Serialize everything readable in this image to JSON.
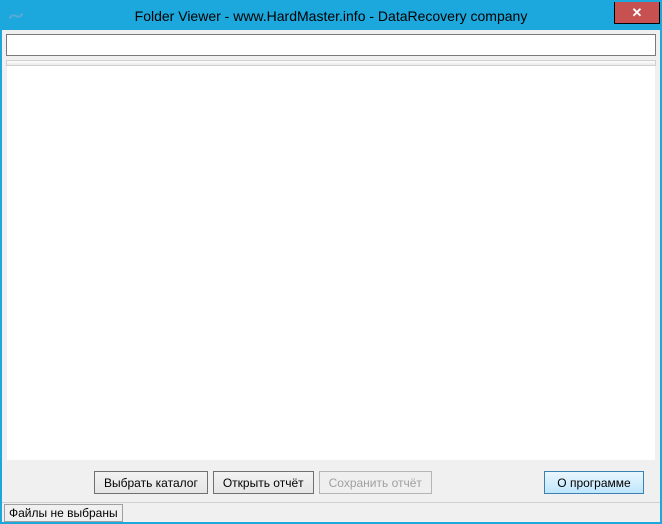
{
  "window": {
    "title": "Folder Viewer - www.HardMaster.info - DataRecovery company"
  },
  "path_input": {
    "value": ""
  },
  "buttons": {
    "select_folder": "Выбрать каталог",
    "open_report": "Открыть отчёт",
    "save_report": "Сохранить отчёт",
    "about": "О программе"
  },
  "status": {
    "text": "Файлы не выбраны"
  }
}
